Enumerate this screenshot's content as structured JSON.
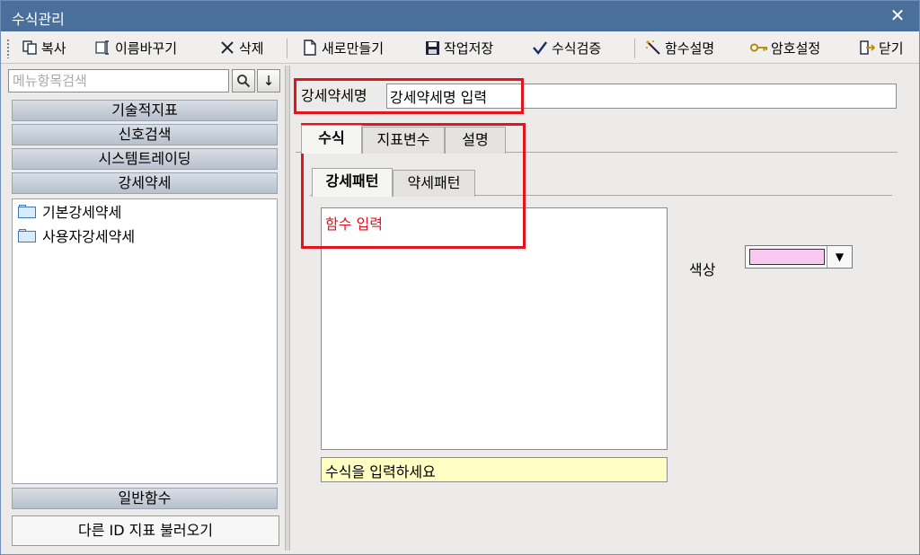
{
  "window": {
    "title": "수식관리"
  },
  "toolbar": {
    "copy": "복사",
    "rename": "이름바꾸기",
    "delete": "삭제",
    "new": "새로만들기",
    "save": "작업저장",
    "verify": "수식검증",
    "func_help": "함수설명",
    "password": "암호설정",
    "close": "닫기"
  },
  "left": {
    "search_placeholder": "메뉴항목검색",
    "categories": [
      "기술적지표",
      "신호검색",
      "시스템트레이딩",
      "강세약세"
    ],
    "tree_items": [
      "기본강세약세",
      "사용자강세약세"
    ],
    "bottom_category": "일반함수",
    "load_button": "다른 ID 지표 불러오기"
  },
  "right": {
    "name_label": "강세약세명",
    "name_value": "강세약세명 입력",
    "tabs": [
      "수식",
      "지표변수",
      "설명"
    ],
    "subtabs": [
      "강세패턴",
      "약세패턴"
    ],
    "formula_text": "함수 입력",
    "status_text": "수식을 입력하세요",
    "color_label": "색상",
    "color_value": "#f9c8f0",
    "highlight_color": "#e3141d"
  }
}
